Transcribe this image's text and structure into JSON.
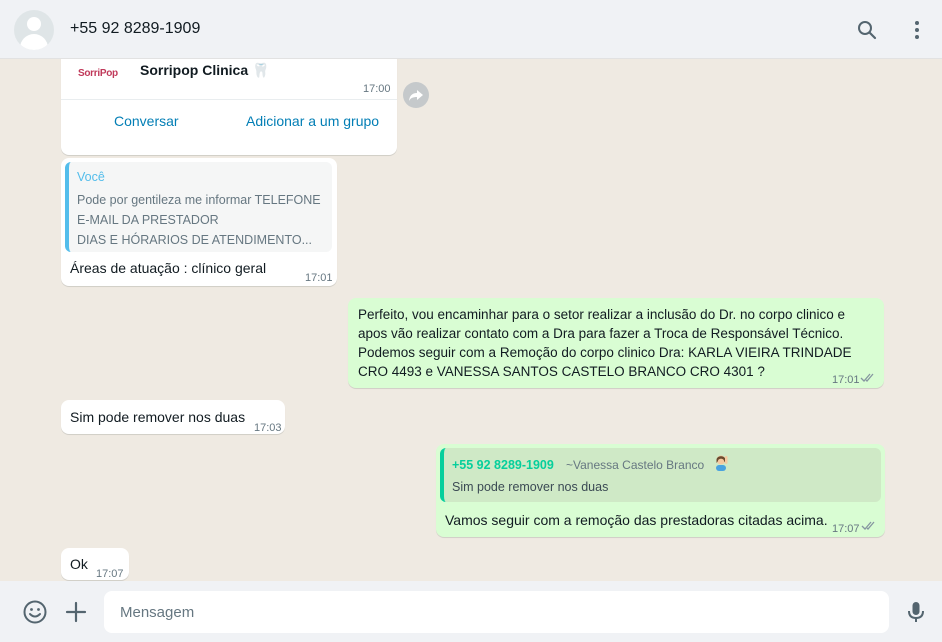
{
  "header": {
    "contact_name": "+55 92 8289-1909"
  },
  "icons": {
    "search": "search-icon",
    "menu": "menu-icon",
    "forward": "forward-icon",
    "emoji": "emoji-icon",
    "attach": "plus-icon",
    "mic": "mic-icon"
  },
  "messages": {
    "card": {
      "logo_text": "SorriPop",
      "name": "Sorripop Clinica 🦷",
      "time": "17:00",
      "action_chat": "Conversar",
      "action_group": "Adicionar a um grupo"
    },
    "reply": {
      "quote_author": "Você",
      "quote_lines": [
        "Pode por gentileza me informar TELEFONE",
        "E-MAIL DA PRESTADOR",
        "DIAS E HÓRARIOS DE ATENDIMENTO..."
      ],
      "text": "Áreas de atuação : clínico geral",
      "time": "17:01"
    },
    "out1": {
      "lines": [
        "Perfeito, vou encaminhar para o setor realizar a inclusão do Dr. no corpo clinico e",
        "apos vão realizar contato com a Dra para fazer a Troca de Responsável Técnico.",
        "Podemos seguir com a Remoção do corpo clinico  Dra: KARLA VIEIRA TRINDADE",
        "CRO 4493 e  VANESSA SANTOS CASTELO BRANCO CRO 4301 ?"
      ],
      "time": "17:01"
    },
    "in2": {
      "text": "Sim pode remover nos duas",
      "time": "17:03"
    },
    "out2": {
      "quote_number": "+55 92 8289-1909",
      "quote_name": "~Vanessa Castelo Branco",
      "quote_text": "Sim pode remover nos duas",
      "text": "Vamos seguir com a remoção das prestadoras citadas acima.",
      "time": "17:07"
    },
    "in3": {
      "text": "Ok",
      "time": "17:07"
    }
  },
  "composer": {
    "placeholder": "Mensagem"
  },
  "colors": {
    "outgoing_bubble": "#d9fdd3",
    "incoming_bubble": "#ffffff",
    "background": "#efeae2",
    "read_ticks": "#53bdeb",
    "link": "#027eb5"
  }
}
